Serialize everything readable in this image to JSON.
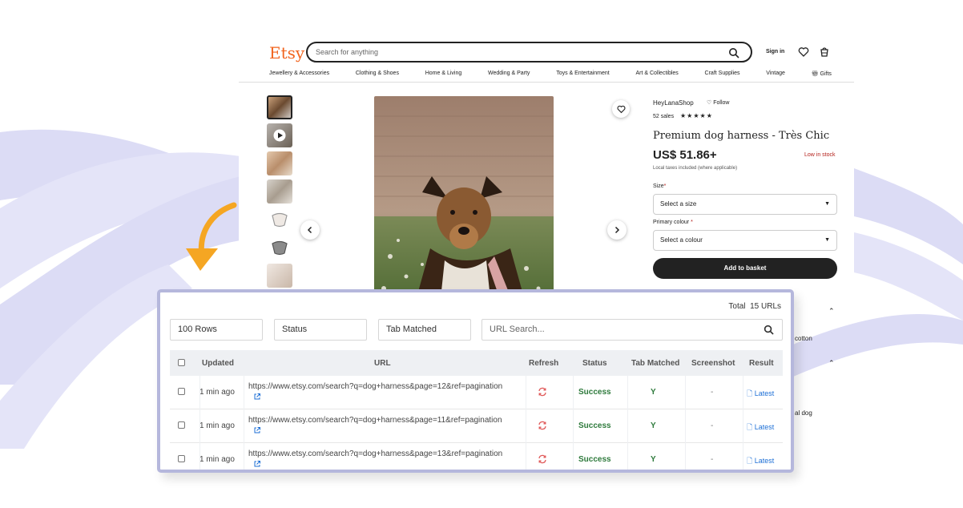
{
  "etsy": {
    "logo": "Etsy",
    "search_placeholder": "Search for anything",
    "signin": "Sign in",
    "categories": [
      "Jewellery & Accessories",
      "Clothing & Shoes",
      "Home & Living",
      "Wedding & Party",
      "Toys & Entertainment",
      "Art & Collectibles",
      "Craft Supplies",
      "Vintage",
      "Gifts"
    ],
    "shop_name": "HeyLanaShop",
    "follow": "Follow",
    "sales": "52 sales",
    "stars": "★★★★★",
    "title": "Premium dog harness - Très Chic",
    "price": "US$ 51.86+",
    "stock": "Low in stock",
    "tax": "Local taxes included (where applicable)",
    "size_label": "Size",
    "size_value": "Select a size",
    "colour_label": "Primary colour",
    "colour_value": "Select a colour",
    "basket": "Add to basket",
    "side_text_1": "cotton",
    "side_text_2": "al dog"
  },
  "panel": {
    "total_label": "Total",
    "total_value": "15 URLs",
    "rows_select": "100 Rows",
    "status_select": "Status",
    "tab_select": "Tab Matched",
    "url_search_placeholder": "URL Search...",
    "headers": {
      "updated": "Updated",
      "url": "URL",
      "refresh": "Refresh",
      "status": "Status",
      "tab_matched": "Tab Matched",
      "screenshot": "Screenshot",
      "result": "Result"
    },
    "rows": [
      {
        "updated": "1 min ago",
        "url": "https://www.etsy.com/search?q=dog+harness&page=12&ref=pagination",
        "status": "Success",
        "tab": "Y",
        "screenshot": "-",
        "result": "Latest"
      },
      {
        "updated": "1 min ago",
        "url": "https://www.etsy.com/search?q=dog+harness&page=11&ref=pagination",
        "status": "Success",
        "tab": "Y",
        "screenshot": "-",
        "result": "Latest"
      },
      {
        "updated": "1 min ago",
        "url": "https://www.etsy.com/search?q=dog+harness&page=13&ref=pagination",
        "status": "Success",
        "tab": "Y",
        "screenshot": "-",
        "result": "Latest"
      }
    ]
  },
  "colors": {
    "etsy_orange": "#f1641e",
    "swoosh": "#dcdcf5",
    "panel_border": "#b5b7dc",
    "success_green": "#2e7a3c",
    "link_blue": "#1d6fd6",
    "arrow_orange": "#f5a623"
  }
}
